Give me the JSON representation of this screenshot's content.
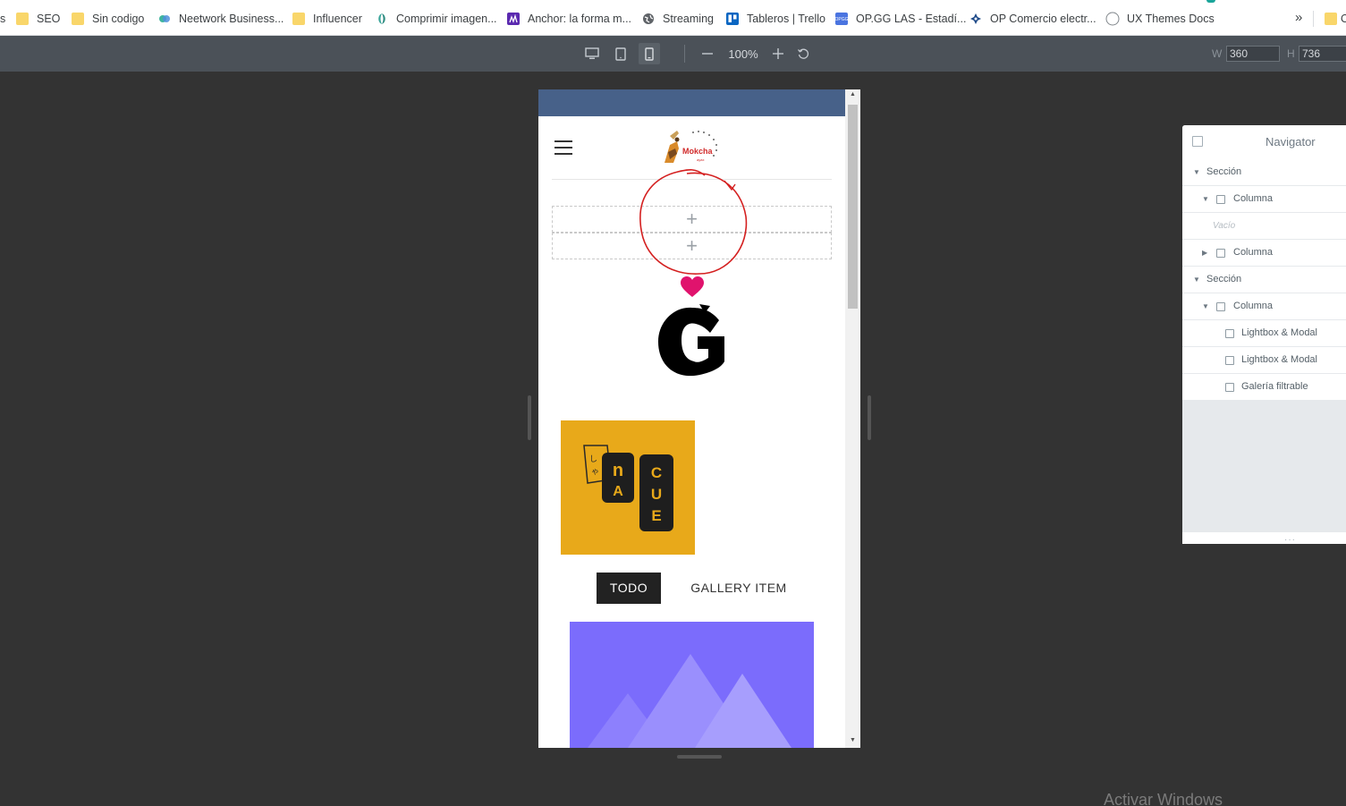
{
  "bookmarks": {
    "cut_label": "s",
    "items": [
      {
        "label": "SEO",
        "icon": "folder-icon"
      },
      {
        "label": "Sin codigo",
        "icon": "folder-icon"
      },
      {
        "label": "Neetwork Business...",
        "icon": "neetwork-icon"
      },
      {
        "label": "Influencer",
        "icon": "folder-icon"
      },
      {
        "label": "Comprimir imagen...",
        "icon": "compress-icon"
      },
      {
        "label": "Anchor: la forma m...",
        "icon": "anchor-icon"
      },
      {
        "label": "Streaming",
        "icon": "globe-icon"
      },
      {
        "label": "Tableros | Trello",
        "icon": "trello-icon"
      },
      {
        "label": "OP.GG LAS - Estadí...",
        "icon": "opgg-icon"
      },
      {
        "label": "OP Comercio electr...",
        "icon": "op-commerce-icon"
      },
      {
        "label": "UX Themes Docs",
        "icon": "circle-icon"
      }
    ],
    "more_label": "»",
    "last_folder_label": "O"
  },
  "toolbar": {
    "devices": [
      "desktop-icon",
      "tablet-icon",
      "mobile-icon"
    ],
    "active_device": "mobile",
    "zoom_label": "100%",
    "width_label": "W",
    "width_value": "360",
    "height_label": "H",
    "height_value": "736"
  },
  "preview": {
    "logo_text": "Mokcha",
    "dropzone_plus": "+",
    "filter_buttons": {
      "todo": "TODO",
      "gallery_item": "GALLERY ITEM"
    },
    "colors": {
      "header": "#476189",
      "gallery_bg": "#e8a91a",
      "placeholder": "#7b6cfc",
      "active_filter": "#222222"
    }
  },
  "navigator": {
    "title": "Navigator",
    "rows": [
      {
        "label": "Sección",
        "level": 0,
        "arrow": "▼",
        "icon": ""
      },
      {
        "label": "Columna",
        "level": 1,
        "arrow": "▼",
        "icon": "column-icon"
      },
      {
        "label": "Vacío",
        "level": 2,
        "arrow": "",
        "icon": "",
        "empty": true
      },
      {
        "label": "Columna",
        "level": 1,
        "arrow": "▶",
        "icon": "column-icon"
      },
      {
        "label": "Sección",
        "level": 0,
        "arrow": "▼",
        "icon": ""
      },
      {
        "label": "Columna",
        "level": 1,
        "arrow": "▼",
        "icon": "column-icon"
      },
      {
        "label": "Lightbox & Modal",
        "level": 2,
        "arrow": "",
        "icon": "widget-icon"
      },
      {
        "label": "Lightbox & Modal",
        "level": 2,
        "arrow": "",
        "icon": "widget-icon"
      },
      {
        "label": "Galería filtrable",
        "level": 2,
        "arrow": "",
        "icon": "gallery-icon"
      }
    ],
    "grip": "···"
  },
  "watermark": "Activar Windows"
}
